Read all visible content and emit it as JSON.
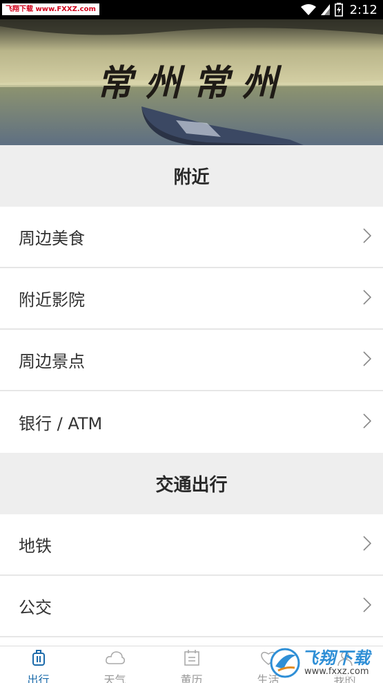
{
  "status_bar": {
    "watermark": "飞翔下载 www.FXXZ.com",
    "time": "2:12"
  },
  "banner": {
    "title": "常州常州"
  },
  "sections": [
    {
      "title": "附近",
      "items": [
        "周边美食",
        "附近影院",
        "周边景点",
        "银行 / ATM"
      ]
    },
    {
      "title": "交通出行",
      "items": [
        "地铁",
        "公交"
      ]
    }
  ],
  "bottom_nav": {
    "items": [
      {
        "label": "出行",
        "icon": "luggage-icon",
        "active": true
      },
      {
        "label": "天气",
        "icon": "cloud-icon",
        "active": false
      },
      {
        "label": "黄历",
        "icon": "calendar-icon",
        "active": false
      },
      {
        "label": "生活",
        "icon": "heart-icon",
        "active": false
      },
      {
        "label": "我的",
        "icon": "user-icon",
        "active": false
      }
    ]
  },
  "watermark_corner": {
    "brand": "飞翔下载",
    "url": "www.fxxz.com"
  },
  "colors": {
    "accent": "#1a6aaa",
    "section_bg": "#eeeeee",
    "watermark_red": "#d0021b"
  }
}
